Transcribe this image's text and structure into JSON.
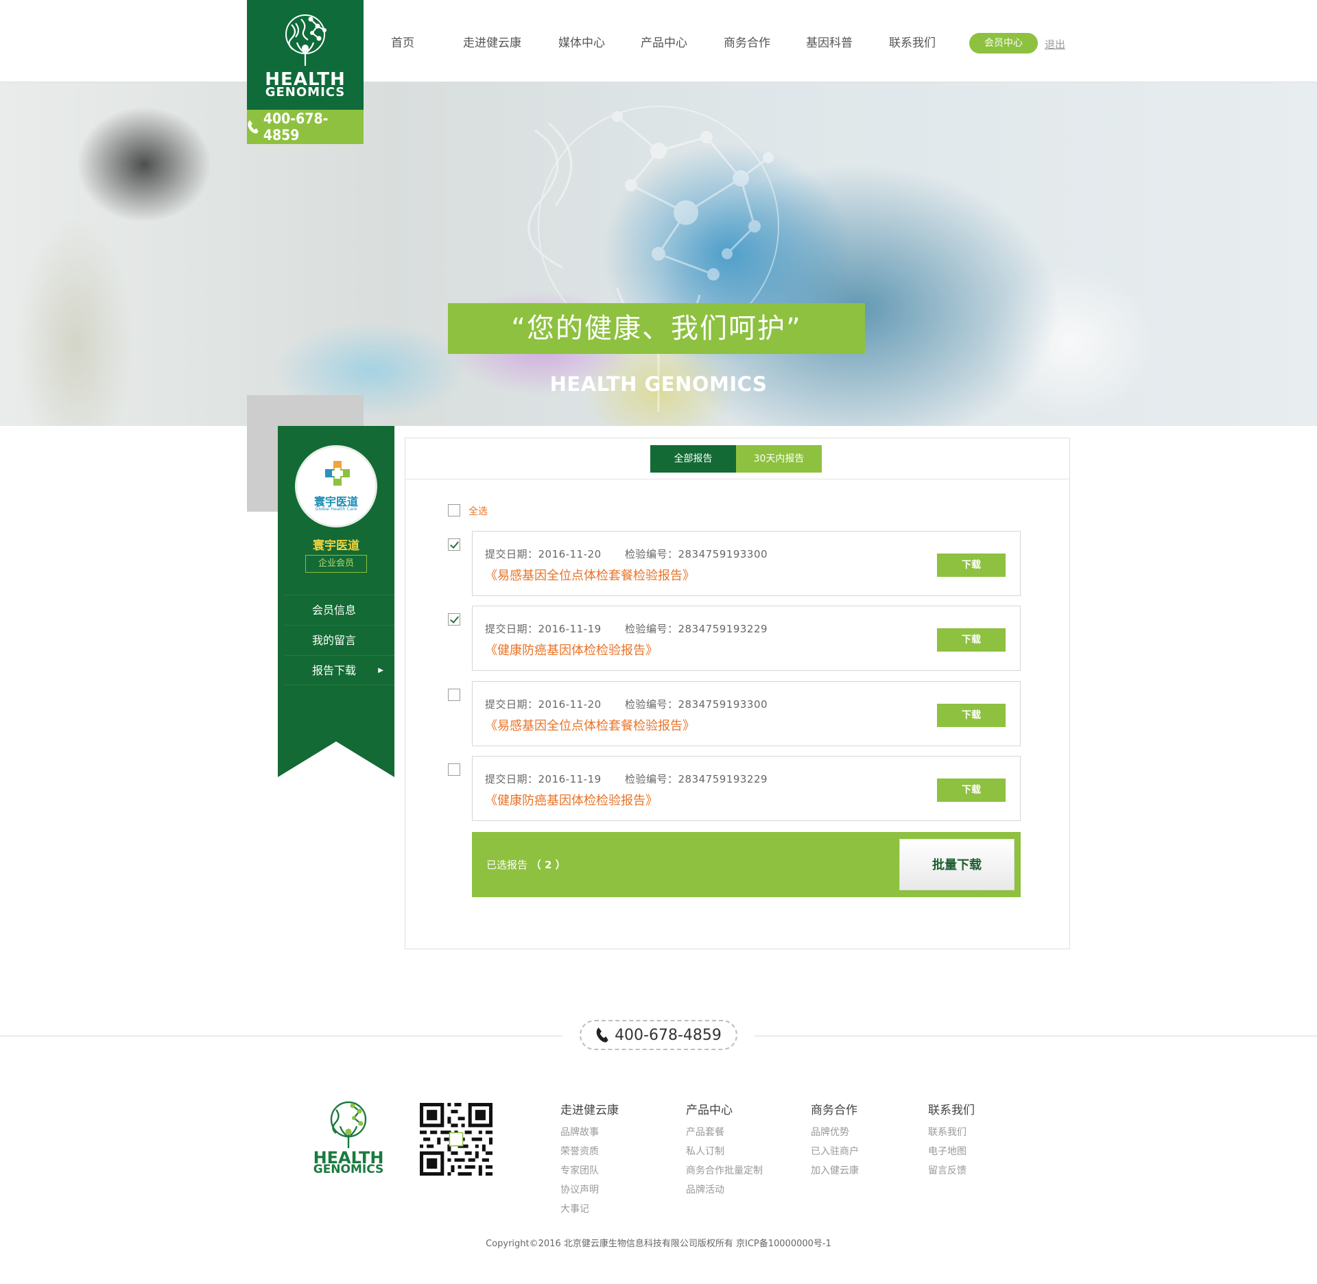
{
  "brand": {
    "logo_line1": "HEALTH",
    "logo_line2": "GENOMICS",
    "phone": "400-678-4859",
    "accent_dark": "#136a34",
    "accent_light": "#8dc13f",
    "orange": "#e87327"
  },
  "nav": {
    "items": [
      "首页",
      "走进健云康",
      "媒体中心",
      "产品中心",
      "商务合作",
      "基因科普",
      "联系我们"
    ],
    "member_center": "会员中心",
    "logout": "退出"
  },
  "banner": {
    "slogan": "“您的健康、我们呵护”",
    "subtitle": "HEALTH GENOMICS"
  },
  "sidebar": {
    "avatar_name": "寰宇医道",
    "avatar_en": "Global Health Care",
    "company": "寰宇医道",
    "badge": "企业会员",
    "items": [
      {
        "label": "会员信息",
        "active": false
      },
      {
        "label": "我的留言",
        "active": false
      },
      {
        "label": "报告下载",
        "active": true
      }
    ]
  },
  "reports": {
    "tabs": [
      {
        "label": "全部报告",
        "active": true
      },
      {
        "label": "30天内报告",
        "active": false
      }
    ],
    "select_all": "全选",
    "select_all_checked": false,
    "list": [
      {
        "date_label": "提交日期：2016-11-20",
        "no_label": "检验编号：2834759193300",
        "title": "《易感基因全位点体检套餐检验报告》",
        "checked": true,
        "download": "下载"
      },
      {
        "date_label": "提交日期：2016-11-19",
        "no_label": "检验编号：2834759193229",
        "title": "《健康防癌基因体检检验报告》",
        "checked": true,
        "download": "下载"
      },
      {
        "date_label": "提交日期：2016-11-20",
        "no_label": "检验编号：2834759193300",
        "title": "《易感基因全位点体检套餐检验报告》",
        "checked": false,
        "download": "下载"
      },
      {
        "date_label": "提交日期：2016-11-19",
        "no_label": "检验编号：2834759193229",
        "title": "《健康防癌基因体检检验报告》",
        "checked": false,
        "download": "下载"
      }
    ],
    "selected_label": "已选报告",
    "selected_count": "（ 2 ）",
    "batch_download": "批量下载"
  },
  "footer": {
    "phone": "400-678-4859",
    "columns": [
      {
        "title": "走进健云康",
        "links": [
          "品牌故事",
          "荣誉资质",
          "专家团队",
          "协议声明",
          "大事记"
        ]
      },
      {
        "title": "产品中心",
        "links": [
          "产品套餐",
          "私人订制",
          "商务合作批量定制",
          "品牌活动"
        ]
      },
      {
        "title": "商务合作",
        "links": [
          "品牌优势",
          "已入驻商户",
          "加入健云康"
        ]
      },
      {
        "title": "联系我们",
        "links": [
          "联系我们",
          "电子地图",
          "留言反馈"
        ]
      }
    ],
    "copyright": "Copyright©2016 北京健云康生物信息科技有限公司版权所有  京ICP备10000000号-1"
  }
}
